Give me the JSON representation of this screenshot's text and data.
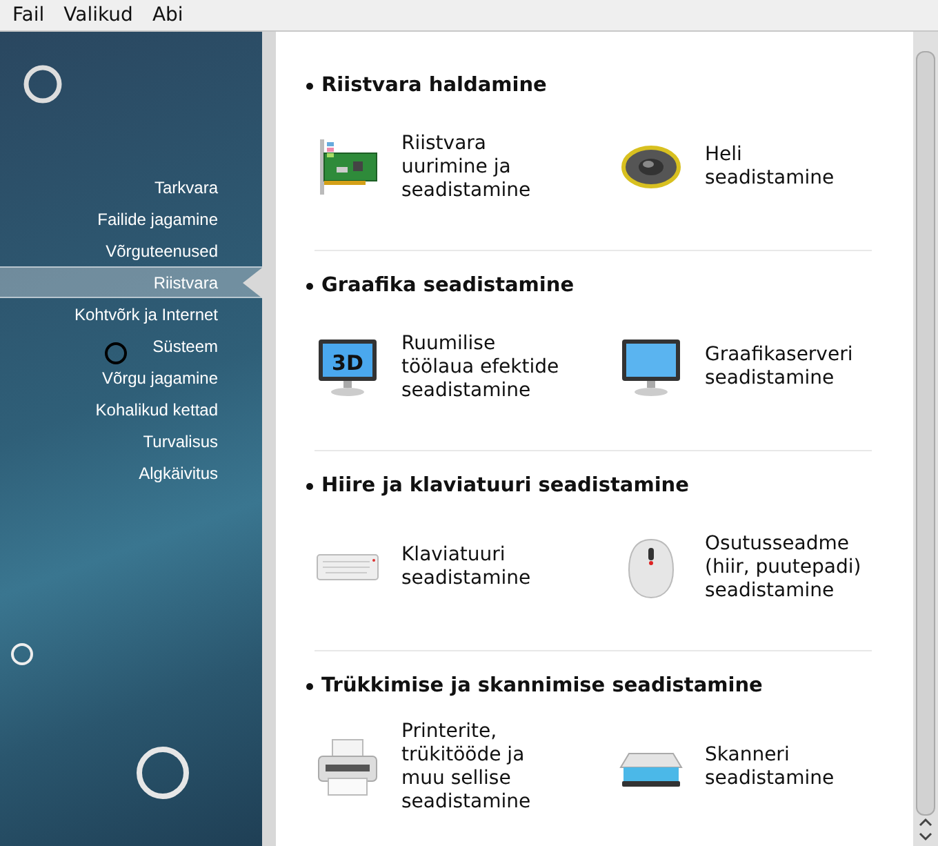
{
  "menu_bar": [
    {
      "label": "Fail"
    },
    {
      "label": "Valikud"
    },
    {
      "label": "Abi"
    }
  ],
  "sidebar": {
    "items": [
      {
        "label": "Tarkvara",
        "selected": false
      },
      {
        "label": "Failide jagamine",
        "selected": false
      },
      {
        "label": "Võrguteenused",
        "selected": false
      },
      {
        "label": "Riistvara",
        "selected": true
      },
      {
        "label": "Kohtvõrk ja Internet",
        "selected": false
      },
      {
        "label": "Süsteem",
        "selected": false
      },
      {
        "label": "Võrgu jagamine",
        "selected": false
      },
      {
        "label": "Kohalikud kettad",
        "selected": false
      },
      {
        "label": "Turvalisus",
        "selected": false
      },
      {
        "label": "Algkäivitus",
        "selected": false
      }
    ]
  },
  "sections": [
    {
      "title": "Riistvara haldamine",
      "items": [
        {
          "kind": "card",
          "label": "Riistvara uurimine ja seadistamine"
        },
        {
          "kind": "speaker",
          "label": "Heli seadistamine"
        }
      ]
    },
    {
      "title": "Graafika seadistamine",
      "items": [
        {
          "kind": "monitor3d",
          "badge": "3D",
          "label": "Ruumilise töölaua efektide seadistamine"
        },
        {
          "kind": "monitor",
          "label": "Graafikaserveri seadistamine"
        }
      ]
    },
    {
      "title": "Hiire ja klaviatuuri seadistamine",
      "items": [
        {
          "kind": "keyboard",
          "label": "Klaviatuuri seadistamine"
        },
        {
          "kind": "mouse",
          "label": "Osutusseadme (hiir, puutepadi) seadistamine"
        }
      ]
    },
    {
      "title": "Trükkimise ja skannimise seadistamine",
      "items": [
        {
          "kind": "printer",
          "label": "Printerite, trükitööde ja muu sellise seadistamine"
        },
        {
          "kind": "scanner",
          "label": "Skanneri seadistamine"
        }
      ]
    }
  ]
}
